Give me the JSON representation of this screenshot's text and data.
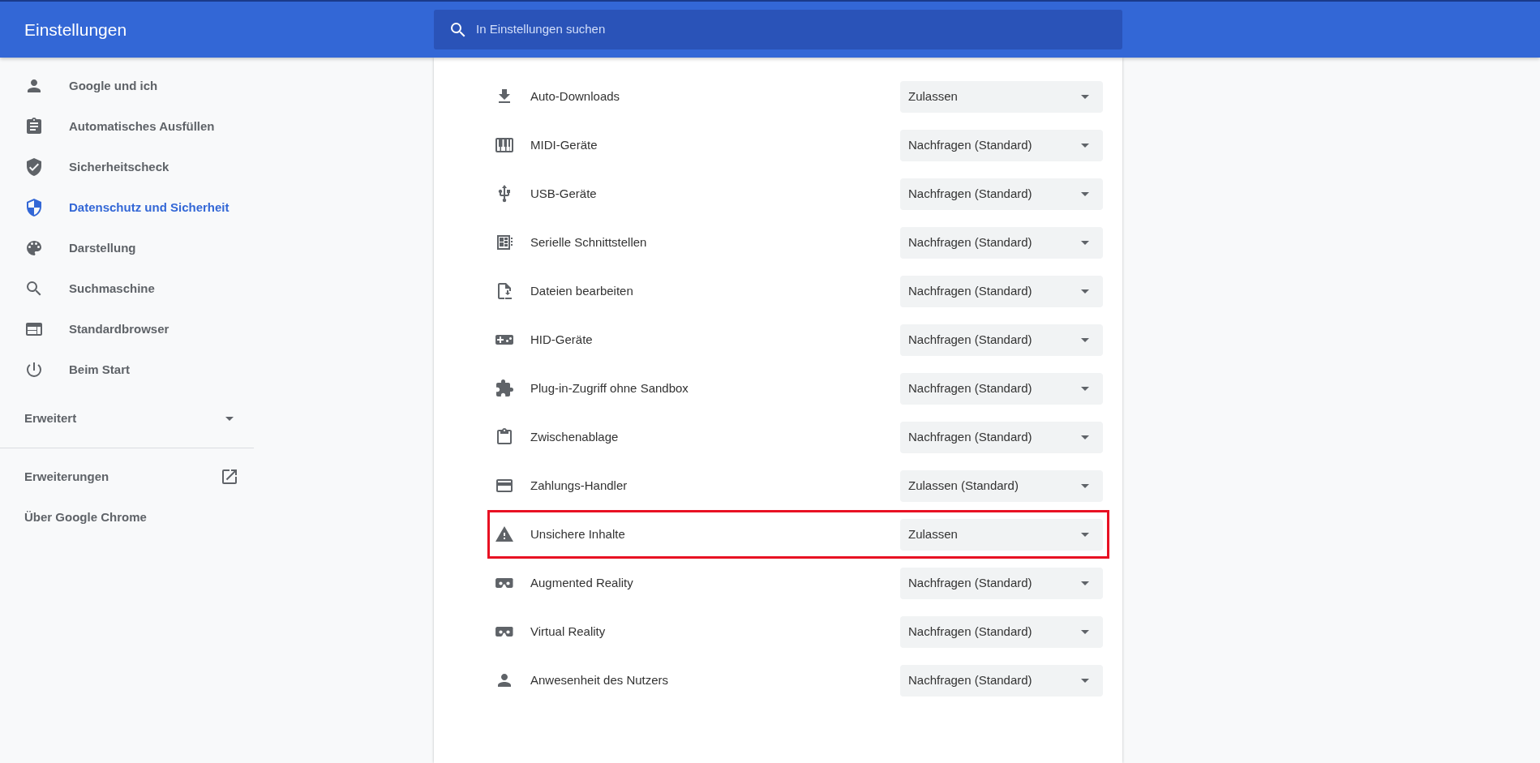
{
  "header": {
    "title": "Einstellungen",
    "search": {
      "placeholder": "In Einstellungen suchen"
    }
  },
  "sidebar": {
    "items": [
      {
        "label": "Google und ich",
        "selected": false
      },
      {
        "label": "Automatisches Ausfüllen",
        "selected": false
      },
      {
        "label": "Sicherheitscheck",
        "selected": false
      },
      {
        "label": "Datenschutz und Sicherheit",
        "selected": true
      },
      {
        "label": "Darstellung",
        "selected": false
      },
      {
        "label": "Suchmaschine",
        "selected": false
      },
      {
        "label": "Standardbrowser",
        "selected": false
      },
      {
        "label": "Beim Start",
        "selected": false
      }
    ],
    "advanced": {
      "label": "Erweitert",
      "expanded": false
    },
    "links": [
      {
        "label": "Erweiterungen",
        "external": true
      },
      {
        "label": "Über Google Chrome",
        "external": false
      }
    ]
  },
  "settings": [
    {
      "label": "Auto-Downloads",
      "value": "Zulassen",
      "highlighted": false
    },
    {
      "label": "MIDI-Geräte",
      "value": "Nachfragen (Standard)",
      "highlighted": false
    },
    {
      "label": "USB-Geräte",
      "value": "Nachfragen (Standard)",
      "highlighted": false
    },
    {
      "label": "Serielle Schnittstellen",
      "value": "Nachfragen (Standard)",
      "highlighted": false
    },
    {
      "label": "Dateien bearbeiten",
      "value": "Nachfragen (Standard)",
      "highlighted": false
    },
    {
      "label": "HID-Geräte",
      "value": "Nachfragen (Standard)",
      "highlighted": false
    },
    {
      "label": "Plug-in-Zugriff ohne Sandbox",
      "value": "Nachfragen (Standard)",
      "highlighted": false
    },
    {
      "label": "Zwischenablage",
      "value": "Nachfragen (Standard)",
      "highlighted": false
    },
    {
      "label": "Zahlungs-Handler",
      "value": "Zulassen (Standard)",
      "highlighted": false
    },
    {
      "label": "Unsichere Inhalte",
      "value": "Zulassen",
      "highlighted": true
    },
    {
      "label": "Augmented Reality",
      "value": "Nachfragen (Standard)",
      "highlighted": false
    },
    {
      "label": "Virtual Reality",
      "value": "Nachfragen (Standard)",
      "highlighted": false
    },
    {
      "label": "Anwesenheit des Nutzers",
      "value": "Nachfragen (Standard)",
      "highlighted": false
    }
  ]
}
